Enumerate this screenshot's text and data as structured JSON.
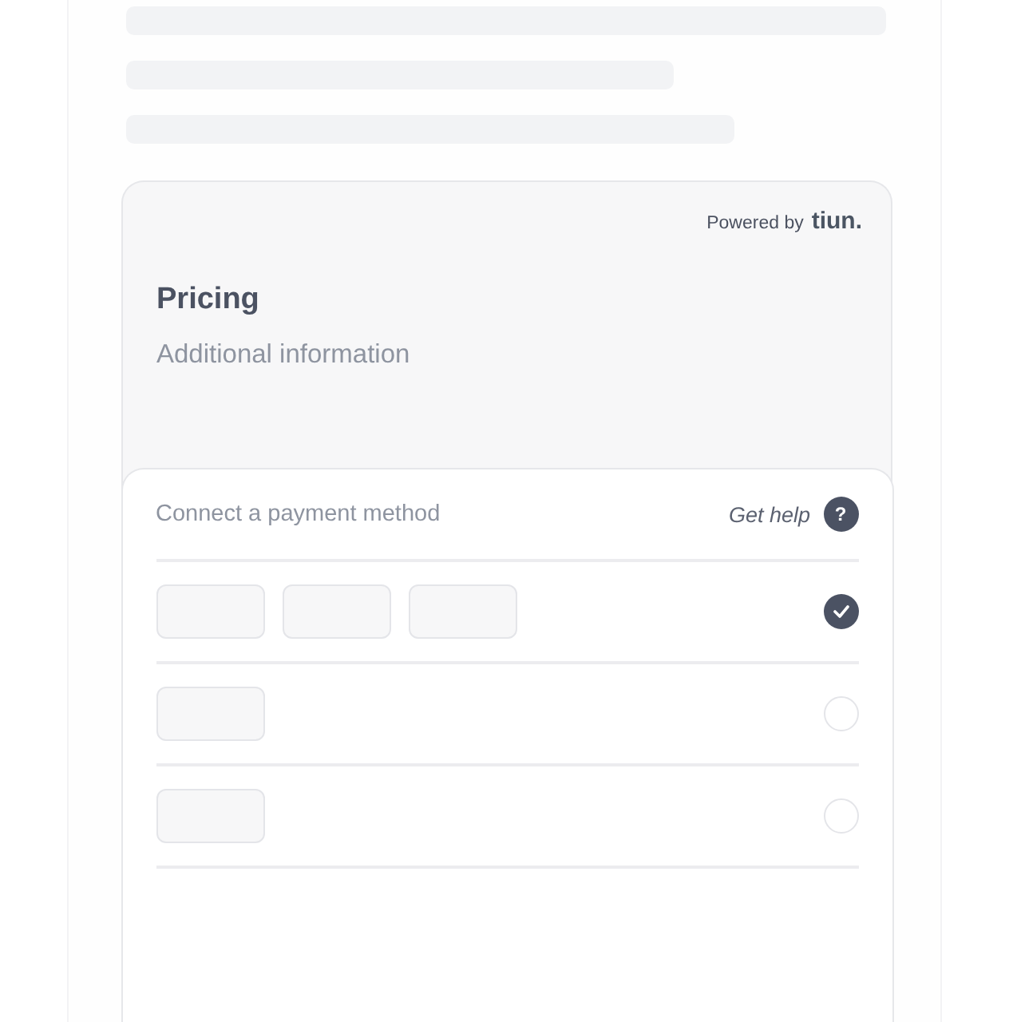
{
  "widget": {
    "powered_by": "Powered by",
    "brand": "tiun.",
    "title": "Pricing",
    "subtitle": "Additional information"
  },
  "payment": {
    "heading": "Connect a payment method",
    "help_link": "Get help",
    "help_icon": "?",
    "methods": [
      {
        "logos": [
          {
            "kind": "placeholder"
          },
          {
            "kind": "placeholder"
          },
          {
            "kind": "placeholder"
          }
        ],
        "selected": true
      },
      {
        "logos": [
          {
            "kind": "placeholder"
          }
        ],
        "selected": false
      },
      {
        "logos": [
          {
            "kind": "placeholder"
          }
        ],
        "selected": false
      }
    ]
  }
}
